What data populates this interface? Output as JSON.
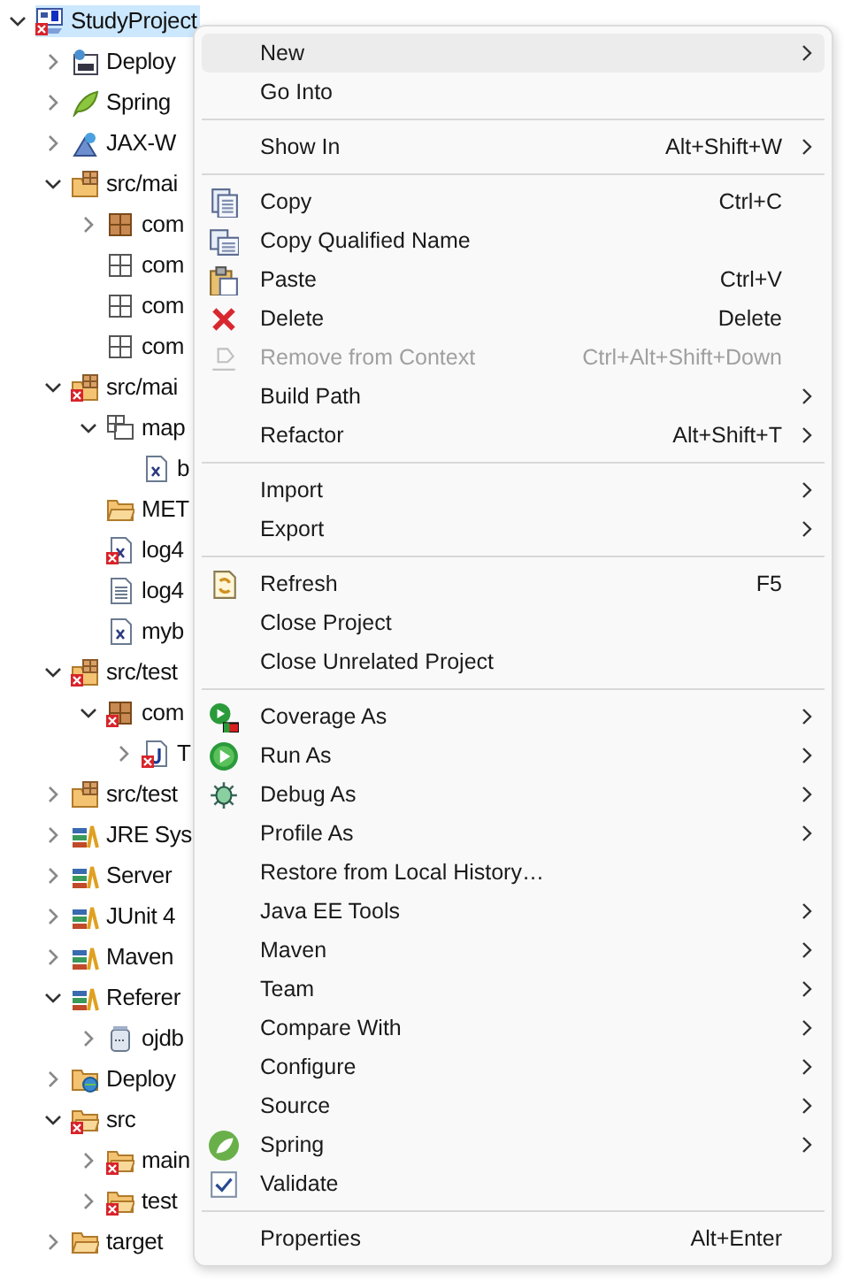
{
  "tree": [
    {
      "label": "StudyProject",
      "kind": "branch",
      "expanded": true,
      "selected": true,
      "children": [
        {
          "label": "Deploy",
          "kind": "branch",
          "expanded": false,
          "selected": false
        },
        {
          "label": "Spring",
          "kind": "branch",
          "expanded": false,
          "selected": false
        },
        {
          "label": "JAX-W",
          "kind": "branch",
          "expanded": false,
          "selected": false
        },
        {
          "label": "src/mai",
          "kind": "branch",
          "expanded": true,
          "selected": false,
          "children": [
            {
              "label": "com",
              "kind": "branch",
              "expanded": false,
              "selected": false
            },
            {
              "label": "com",
              "kind": "leaf",
              "selected": false
            },
            {
              "label": "com",
              "kind": "leaf",
              "selected": false
            },
            {
              "label": "com",
              "kind": "leaf",
              "selected": false
            }
          ]
        },
        {
          "label": "src/mai",
          "kind": "branch",
          "expanded": true,
          "selected": false,
          "children": [
            {
              "label": "map",
              "kind": "branch",
              "expanded": true,
              "selected": false,
              "children": [
                {
                  "label": "b",
                  "kind": "leaf",
                  "selected": false
                }
              ]
            },
            {
              "label": "MET",
              "kind": "leaf",
              "selected": false
            },
            {
              "label": "log4",
              "kind": "leaf",
              "selected": false
            },
            {
              "label": "log4",
              "kind": "leaf",
              "selected": false
            },
            {
              "label": "myb",
              "kind": "leaf",
              "selected": false
            }
          ]
        },
        {
          "label": "src/test",
          "kind": "branch",
          "expanded": true,
          "selected": false,
          "children": [
            {
              "label": "com",
              "kind": "branch",
              "expanded": true,
              "selected": false,
              "children": [
                {
                  "label": "T",
                  "kind": "branch",
                  "expanded": false,
                  "selected": false
                }
              ]
            }
          ]
        },
        {
          "label": "src/test",
          "kind": "branch",
          "expanded": false,
          "selected": false
        },
        {
          "label": "JRE Sys",
          "kind": "branch",
          "expanded": false,
          "selected": false
        },
        {
          "label": "Server",
          "kind": "branch",
          "expanded": false,
          "selected": false
        },
        {
          "label": "JUnit 4",
          "kind": "branch",
          "expanded": false,
          "selected": false
        },
        {
          "label": "Maven",
          "kind": "branch",
          "expanded": false,
          "selected": false
        },
        {
          "label": "Referer",
          "kind": "branch",
          "expanded": true,
          "selected": false,
          "children": [
            {
              "label": "ojdb",
              "kind": "branch",
              "expanded": false,
              "selected": false
            }
          ]
        },
        {
          "label": "Deploy",
          "kind": "branch",
          "expanded": false,
          "selected": false
        },
        {
          "label": "src",
          "kind": "branch",
          "expanded": true,
          "selected": false,
          "children": [
            {
              "label": "main",
              "kind": "branch",
              "expanded": false,
              "selected": false
            },
            {
              "label": "test",
              "kind": "branch",
              "expanded": false,
              "selected": false
            }
          ]
        },
        {
          "label": "target",
          "kind": "branch",
          "expanded": false,
          "selected": false
        }
      ]
    }
  ],
  "context_menu": [
    {
      "kind": "item",
      "label": "New",
      "submenu": true,
      "selected": true,
      "disabled": false
    },
    {
      "kind": "item",
      "label": "Go Into",
      "submenu": false,
      "selected": false,
      "disabled": false
    },
    {
      "kind": "separator"
    },
    {
      "kind": "item",
      "label": "Show In",
      "shortcut": "Alt+Shift+W",
      "submenu": true,
      "selected": false,
      "disabled": false
    },
    {
      "kind": "separator"
    },
    {
      "kind": "item",
      "label": "Copy",
      "shortcut": "Ctrl+C",
      "submenu": false,
      "selected": false,
      "disabled": false
    },
    {
      "kind": "item",
      "label": "Copy Qualified Name",
      "submenu": false,
      "selected": false,
      "disabled": false
    },
    {
      "kind": "item",
      "label": "Paste",
      "shortcut": "Ctrl+V",
      "submenu": false,
      "selected": false,
      "disabled": false
    },
    {
      "kind": "item",
      "label": "Delete",
      "shortcut": "Delete",
      "submenu": false,
      "selected": false,
      "disabled": false
    },
    {
      "kind": "item",
      "label": "Remove from Context",
      "shortcut": "Ctrl+Alt+Shift+Down",
      "submenu": false,
      "selected": false,
      "disabled": true
    },
    {
      "kind": "item",
      "label": "Build Path",
      "submenu": true,
      "selected": false,
      "disabled": false
    },
    {
      "kind": "item",
      "label": "Refactor",
      "shortcut": "Alt+Shift+T",
      "submenu": true,
      "selected": false,
      "disabled": false
    },
    {
      "kind": "separator"
    },
    {
      "kind": "item",
      "label": "Import",
      "submenu": true,
      "selected": false,
      "disabled": false
    },
    {
      "kind": "item",
      "label": "Export",
      "submenu": true,
      "selected": false,
      "disabled": false
    },
    {
      "kind": "separator"
    },
    {
      "kind": "item",
      "label": "Refresh",
      "shortcut": "F5",
      "submenu": false,
      "selected": false,
      "disabled": false
    },
    {
      "kind": "item",
      "label": "Close Project",
      "submenu": false,
      "selected": false,
      "disabled": false
    },
    {
      "kind": "item",
      "label": "Close Unrelated Project",
      "submenu": false,
      "selected": false,
      "disabled": false
    },
    {
      "kind": "separator"
    },
    {
      "kind": "item",
      "label": "Coverage As",
      "submenu": true,
      "selected": false,
      "disabled": false
    },
    {
      "kind": "item",
      "label": "Run As",
      "submenu": true,
      "selected": false,
      "disabled": false
    },
    {
      "kind": "item",
      "label": "Debug As",
      "submenu": true,
      "selected": false,
      "disabled": false
    },
    {
      "kind": "item",
      "label": "Profile As",
      "submenu": true,
      "selected": false,
      "disabled": false
    },
    {
      "kind": "item",
      "label": "Restore from Local History…",
      "submenu": false,
      "selected": false,
      "disabled": false
    },
    {
      "kind": "item",
      "label": "Java EE Tools",
      "submenu": true,
      "selected": false,
      "disabled": false
    },
    {
      "kind": "item",
      "label": "Maven",
      "submenu": true,
      "selected": false,
      "disabled": false
    },
    {
      "kind": "item",
      "label": "Team",
      "submenu": true,
      "selected": false,
      "disabled": false
    },
    {
      "kind": "item",
      "label": "Compare With",
      "submenu": true,
      "selected": false,
      "disabled": false
    },
    {
      "kind": "item",
      "label": "Configure",
      "submenu": true,
      "selected": false,
      "disabled": false
    },
    {
      "kind": "item",
      "label": "Source",
      "submenu": true,
      "selected": false,
      "disabled": false
    },
    {
      "kind": "item",
      "label": "Spring",
      "submenu": true,
      "selected": false,
      "disabled": false
    },
    {
      "kind": "item",
      "label": "Validate",
      "submenu": false,
      "selected": false,
      "disabled": false
    },
    {
      "kind": "separator"
    },
    {
      "kind": "item",
      "label": "Properties",
      "shortcut": "Alt+Enter",
      "submenu": false,
      "selected": false,
      "disabled": false
    }
  ]
}
